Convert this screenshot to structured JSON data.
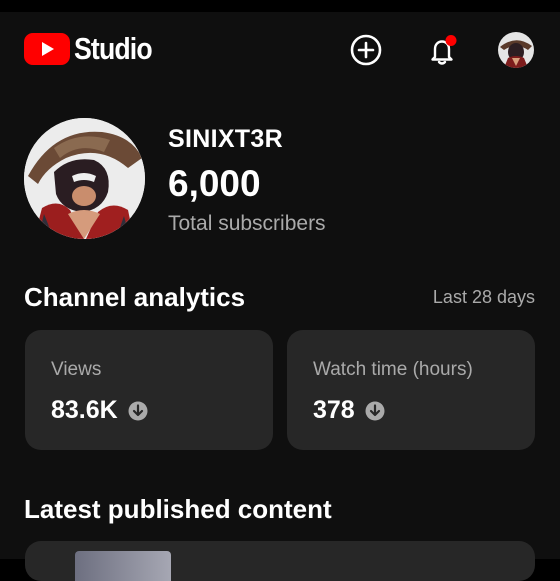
{
  "app": {
    "logo_text": "Studio",
    "brand_color": "#ff0000"
  },
  "header": {
    "icons": [
      "youtube-logo-icon",
      "create-icon",
      "notifications-bell-icon",
      "account-avatar"
    ],
    "notification_dot_color": "#ff0000"
  },
  "channel": {
    "name": "SINIXT3R",
    "subscriber_count": "6,000",
    "subscriber_label": "Total subscribers"
  },
  "analytics": {
    "title": "Channel analytics",
    "period": "Last 28 days",
    "cards": [
      {
        "label": "Views",
        "value": "83.6K",
        "trend_icon": "arrow-down-circle-icon"
      },
      {
        "label": "Watch time (hours)",
        "value": "378",
        "trend_icon": "arrow-down-circle-icon"
      }
    ]
  },
  "latest": {
    "title": "Latest published content"
  },
  "colors": {
    "background": "#0f0f0f",
    "card": "#272727",
    "secondary_text": "#aaaaaa"
  }
}
